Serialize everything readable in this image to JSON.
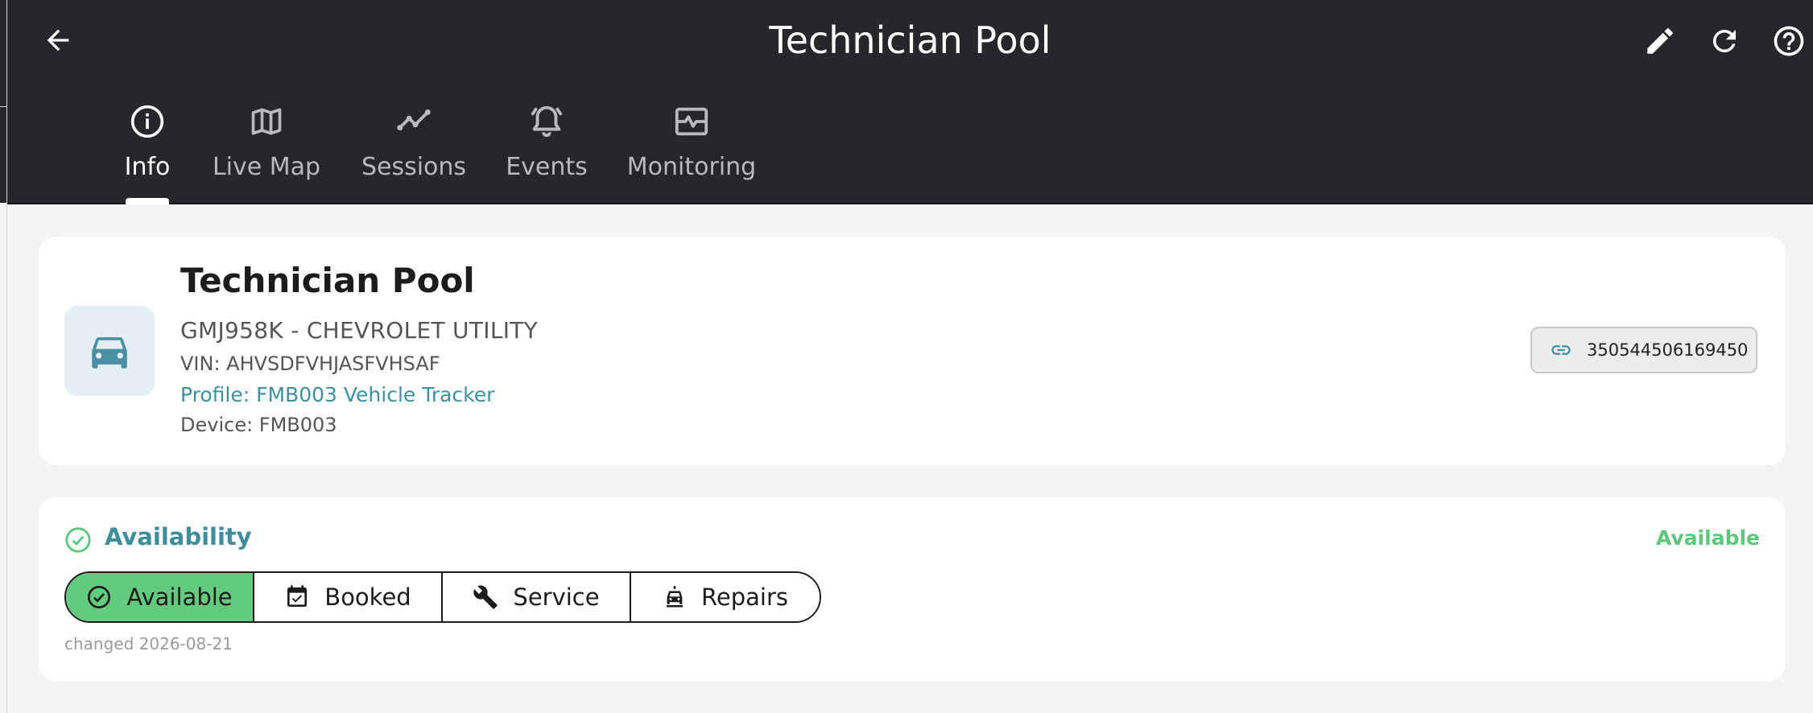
{
  "header": {
    "title": "Technician Pool"
  },
  "tabs": [
    {
      "label": "Info",
      "icon": "info-icon",
      "active": true
    },
    {
      "label": "Live Map",
      "icon": "map-icon",
      "active": false
    },
    {
      "label": "Sessions",
      "icon": "route-icon",
      "active": false
    },
    {
      "label": "Events",
      "icon": "bell-icon",
      "active": false
    },
    {
      "label": "Monitoring",
      "icon": "monitor-icon",
      "active": false
    }
  ],
  "vehicle": {
    "name": "Technician Pool",
    "plate_model": "GMJ958K - CHEVROLET UTILITY",
    "vin": "VIN: AHVSDFVHJASFVHSAF",
    "profile": "Profile: FMB003 Vehicle Tracker",
    "device": "Device: FMB003",
    "imei": "350544506169450",
    "icon": "car-icon"
  },
  "availability": {
    "title": "Availability",
    "status": "Available",
    "changed": "changed 2026-08-21",
    "options": [
      {
        "label": "Available",
        "icon": "check-circle-icon",
        "selected": true
      },
      {
        "label": "Booked",
        "icon": "calendar-check-icon",
        "selected": false
      },
      {
        "label": "Service",
        "icon": "wrench-icon",
        "selected": false
      },
      {
        "label": "Repairs",
        "icon": "car-repair-icon",
        "selected": false
      }
    ]
  },
  "colors": {
    "header_bg": "#26272b",
    "accent_teal": "#3a93a3",
    "available_green": "#63cb7e"
  }
}
